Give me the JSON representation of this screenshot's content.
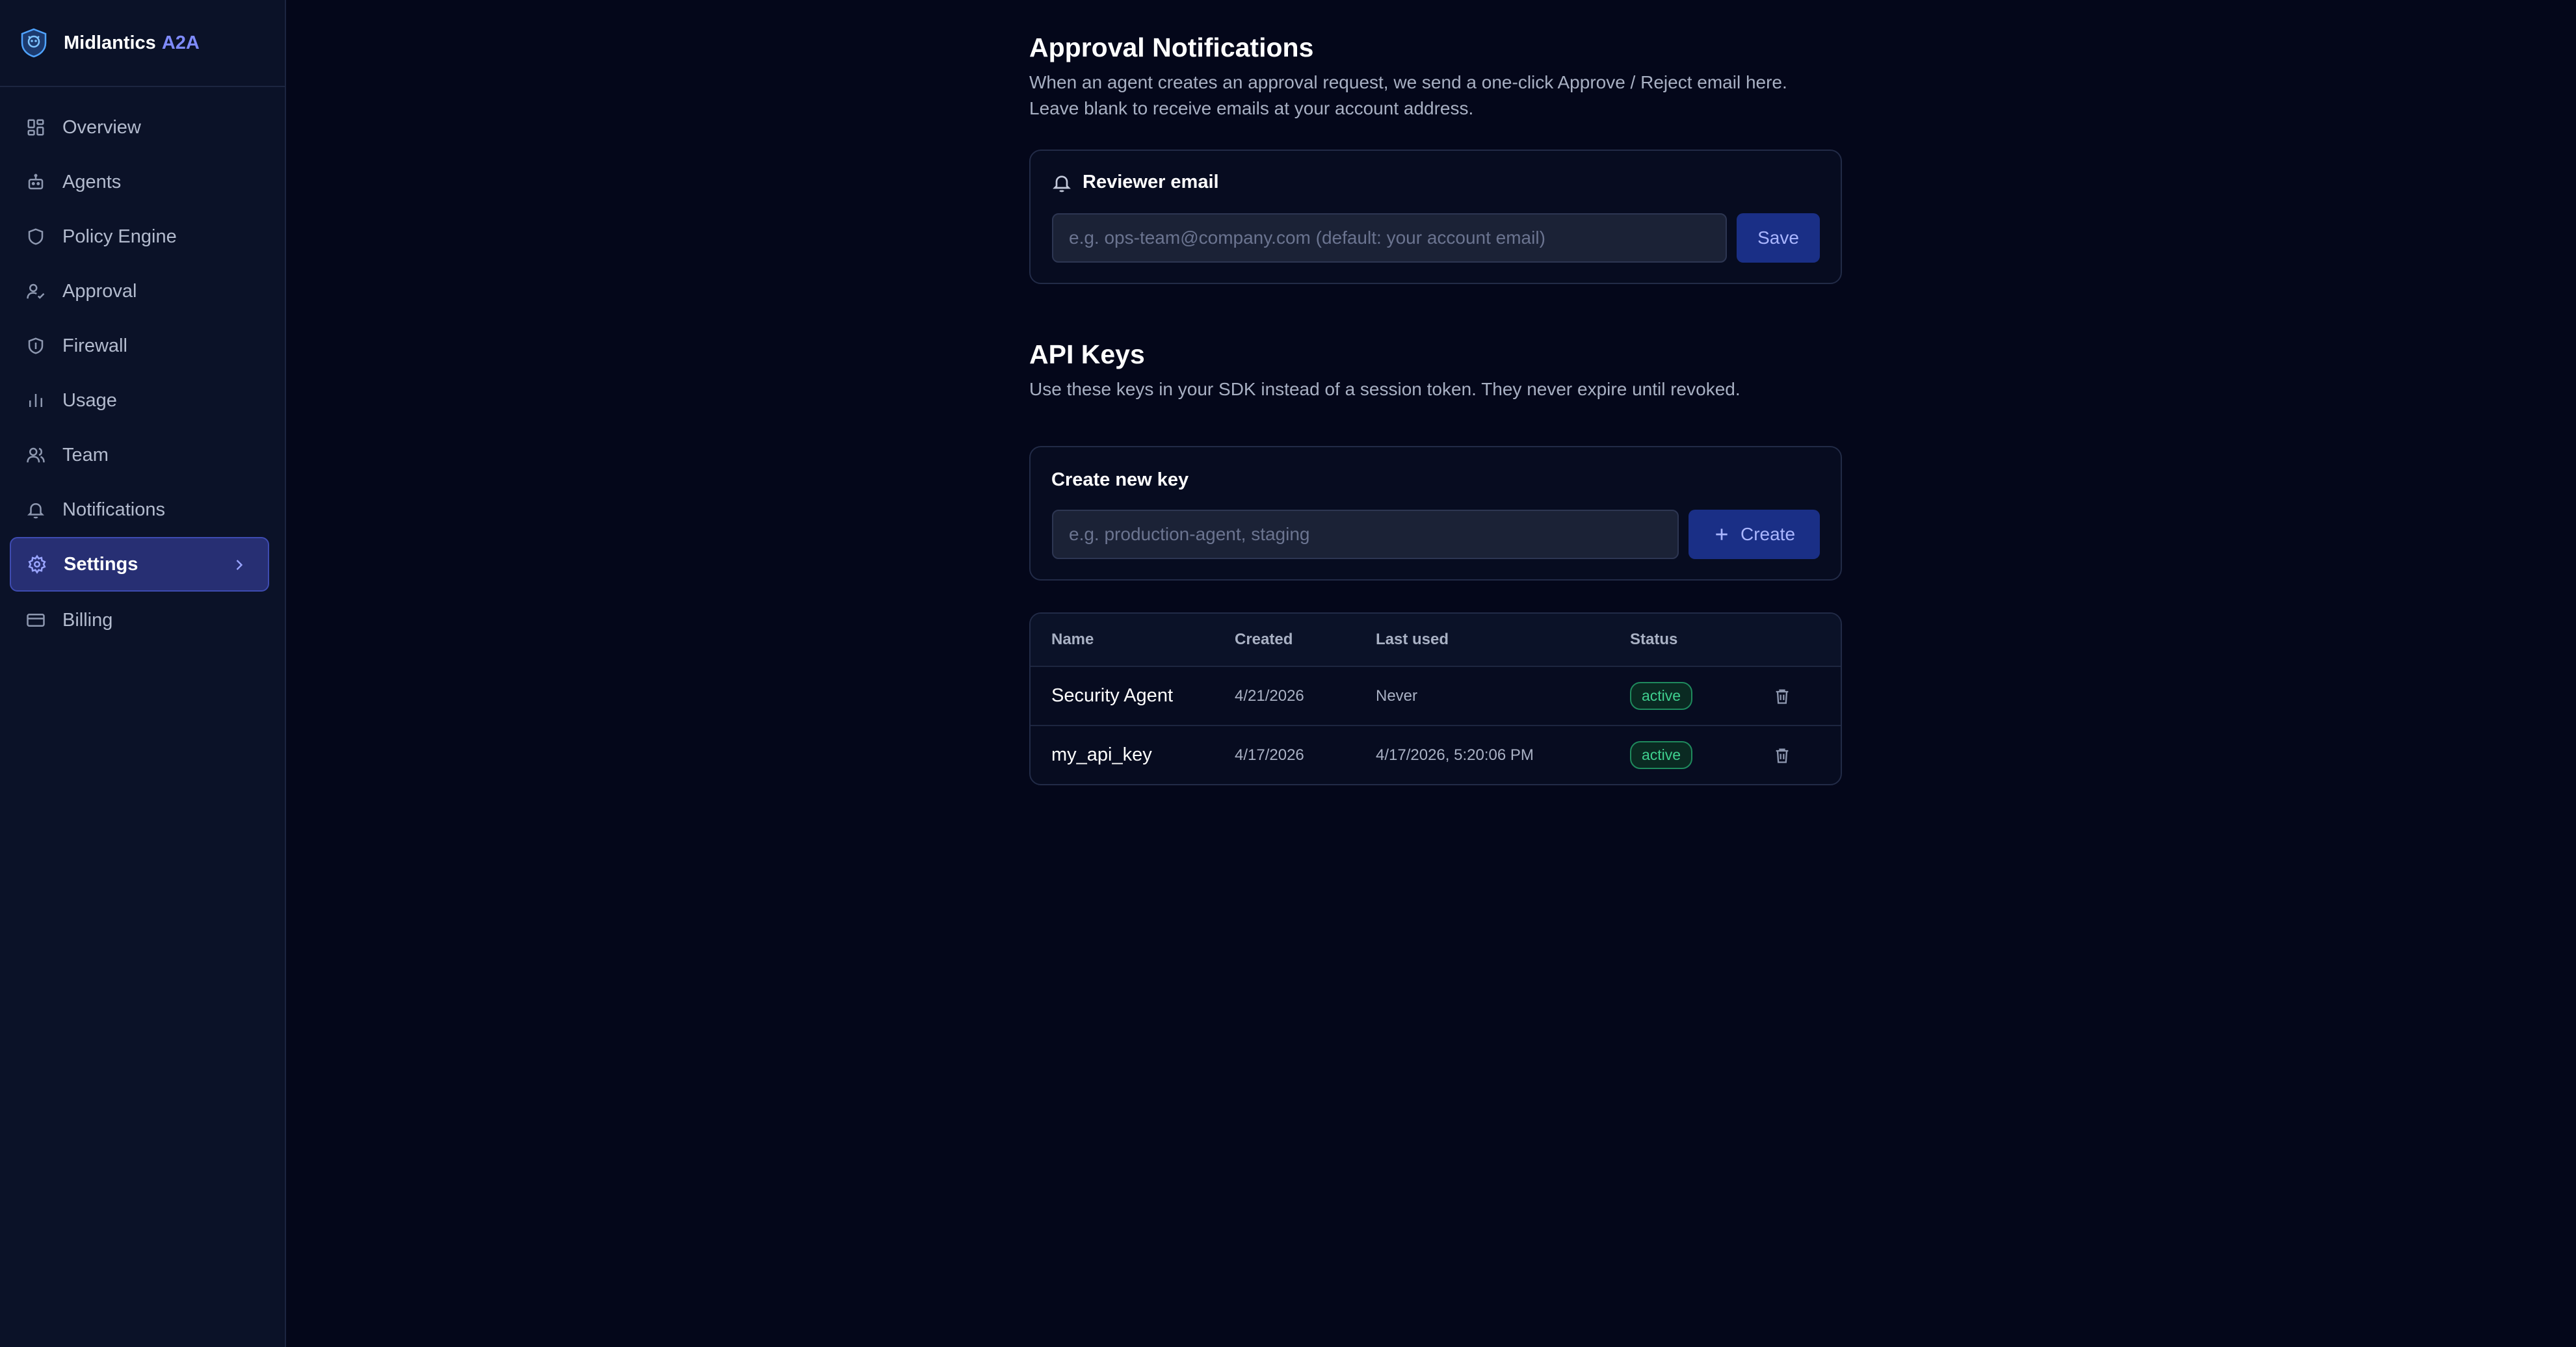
{
  "brand": {
    "name": "Midlantics",
    "accent": "A2A"
  },
  "sidebar": {
    "items": [
      {
        "label": "Overview",
        "icon": "grid-icon"
      },
      {
        "label": "Agents",
        "icon": "bot-icon"
      },
      {
        "label": "Policy Engine",
        "icon": "shield-icon"
      },
      {
        "label": "Approval",
        "icon": "user-check-icon"
      },
      {
        "label": "Firewall",
        "icon": "shield-icon"
      },
      {
        "label": "Usage",
        "icon": "bar-chart-icon"
      },
      {
        "label": "Team",
        "icon": "users-icon"
      },
      {
        "label": "Notifications",
        "icon": "bell-icon"
      },
      {
        "label": "Settings",
        "icon": "gear-icon",
        "active": true
      },
      {
        "label": "Billing",
        "icon": "credit-card-icon"
      }
    ]
  },
  "approval": {
    "title": "Approval Notifications",
    "desc_line1": "When an agent creates an approval request, we send a one-click Approve / Reject email here.",
    "desc_line2": "Leave blank to receive emails at your account address.",
    "card_label": "Reviewer email",
    "placeholder": "e.g. ops-team@company.com (default: your account email)",
    "save_label": "Save"
  },
  "api_keys": {
    "title": "API Keys",
    "desc": "Use these keys in your SDK instead of a session token. They never expire until revoked.",
    "create_label": "Create new key",
    "placeholder": "e.g. production-agent, staging",
    "create_button": "Create",
    "columns": {
      "name": "Name",
      "created": "Created",
      "last_used": "Last used",
      "status": "Status"
    },
    "rows": [
      {
        "name": "Security Agent",
        "created": "4/21/2026",
        "last_used": "Never",
        "status": "active"
      },
      {
        "name": "my_api_key",
        "created": "4/17/2026",
        "last_used": "4/17/2026, 5:20:06 PM",
        "status": "active"
      }
    ]
  },
  "colors": {
    "background": "#04071a",
    "sidebar": "#0b1228",
    "accent": "#7f8bff",
    "active_nav": "#272f73",
    "primary_button": "#1a2f86",
    "status_active": "#3fd08f"
  }
}
